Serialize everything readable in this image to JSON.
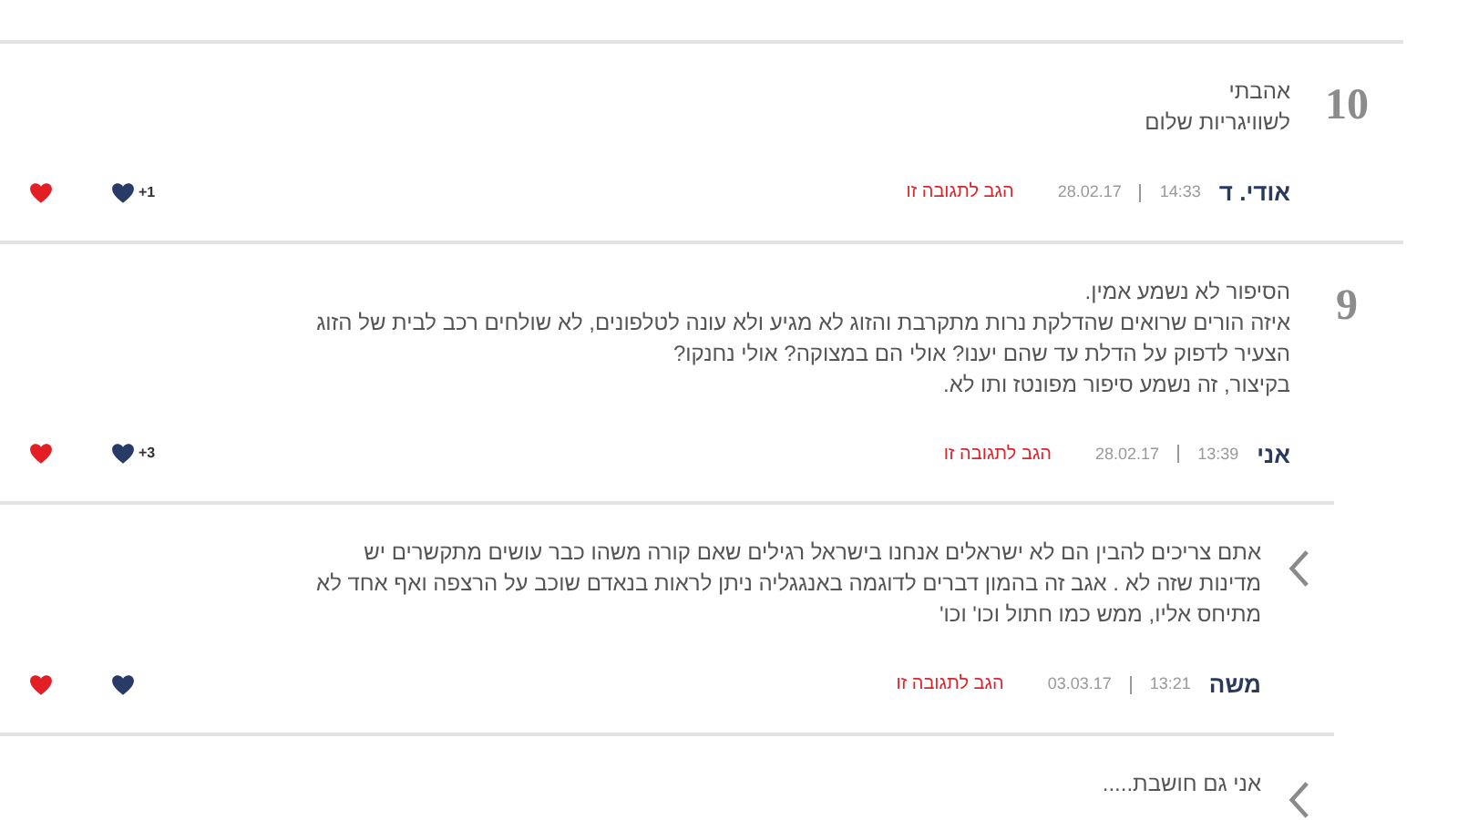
{
  "comments": [
    {
      "kind": "numbered",
      "number": "10",
      "lines": [
        "אהבתי",
        "לשוויגריות שלום"
      ],
      "author": "אודי. ד",
      "time": "14:33",
      "date": "28.02.17",
      "reply_link": "הגב לתגובה זו",
      "likes": "+1"
    },
    {
      "kind": "numbered",
      "number": "9",
      "lines": [
        "הסיפור לא נשמע אמין.",
        "איזה הורים שרואים שהדלקת נרות מתקרבת והזוג לא מגיע ולא עונה לטלפונים, לא שולחים רכב לבית של הזוג",
        "הצעיר לדפוק על הדלת עד שהם יענו? אולי הם במצוקה? אולי נחנקו?",
        "בקיצור, זה נשמע סיפור מפונטז ותו לא."
      ],
      "author": "אני",
      "time": "13:39",
      "date": "28.02.17",
      "reply_link": "הגב לתגובה זו",
      "likes": "+3"
    },
    {
      "kind": "reply",
      "lines": [
        "אתם צריכים להבין הם לא ישראלים אנחנו בישראל רגילים שאם קורה משהו כבר עושים מתקשרים יש",
        "מדינות שזה לא . אגב זה בהמון דברים לדוגמה באנגגליה ניתן לראות בנאדם שוכב על הרצפה ואף אחד לא",
        "מתיחס אליו, ממש כמו חתול וכו' וכו'"
      ],
      "author": "משה",
      "time": "13:21",
      "date": "03.03.17",
      "reply_link": "הגב לתגובה זו"
    },
    {
      "kind": "reply",
      "lines": [
        "אני גם חושבת....."
      ]
    }
  ]
}
